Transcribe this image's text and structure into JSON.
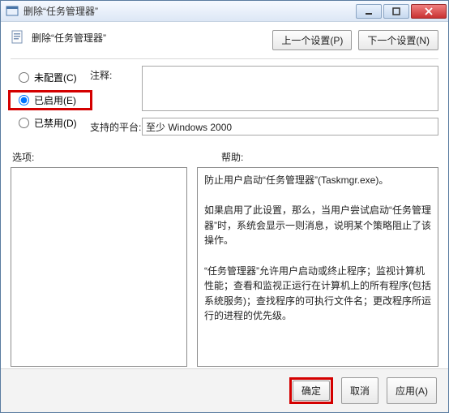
{
  "window": {
    "title": "删除“任务管理器”"
  },
  "header": {
    "text": "删除“任务管理器”"
  },
  "nav": {
    "prev": "上一个设置(P)",
    "next": "下一个设置(N)"
  },
  "radios": {
    "not_configured": "未配置(C)",
    "enabled": "已启用(E)",
    "disabled": "已禁用(D)"
  },
  "form": {
    "comment_label": "注释:",
    "comment_value": "",
    "platform_label": "支持的平台:",
    "platform_value": "至少 Windows 2000"
  },
  "sections": {
    "options": "选项:",
    "help": "帮助:"
  },
  "help_text": {
    "p1": "防止用户启动“任务管理器”(Taskmgr.exe)。",
    "p2": "如果启用了此设置，那么，当用户尝试启动“任务管理器”时，系统会显示一则消息，说明某个策略阻止了该操作。",
    "p3": "“任务管理器”允许用户启动或终止程序；监视计算机性能；查看和监视正运行在计算机上的所有程序(包括系统服务)；查找程序的可执行文件名；更改程序所运行的进程的优先级。"
  },
  "footer": {
    "ok": "确定",
    "cancel": "取消",
    "apply": "应用(A)"
  }
}
